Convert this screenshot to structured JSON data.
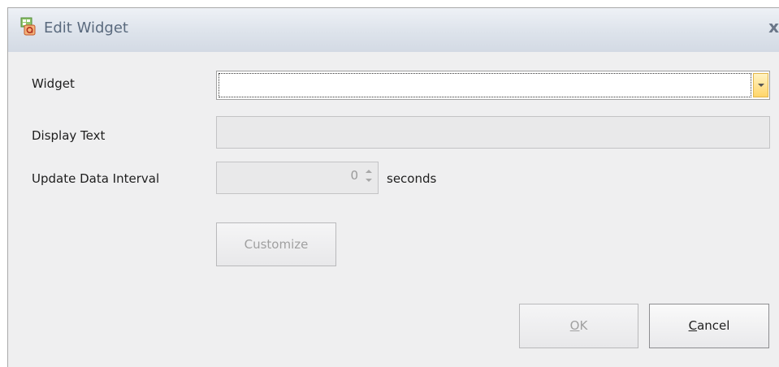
{
  "window": {
    "title": "Edit Widget",
    "close_glyph": "x",
    "icon": "widget-app-icon"
  },
  "form": {
    "widget_label": "Widget",
    "widget_value": "",
    "display_text_label": "Display Text",
    "display_text_value": "",
    "update_interval_label": "Update Data Interval",
    "update_interval_value": "0",
    "update_interval_unit": "seconds"
  },
  "buttons": {
    "customize": "Customize",
    "ok_mnemonic": "O",
    "ok_rest": "K",
    "cancel_mnemonic": "C",
    "cancel_rest": "ancel"
  },
  "colors": {
    "combo_button_accent": "#ffd56a",
    "dialog_bg": "#efeff0",
    "title_text": "#5a6a7e"
  }
}
